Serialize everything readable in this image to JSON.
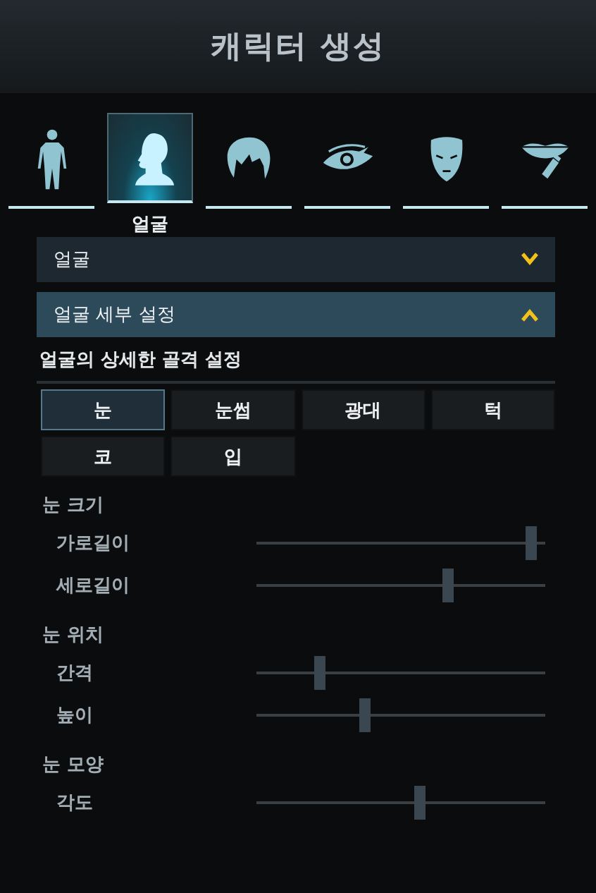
{
  "title": "캐릭터 생성",
  "tabs": [
    {
      "kind": "body",
      "selected": false
    },
    {
      "kind": "head",
      "selected": true,
      "label": "얼굴"
    },
    {
      "kind": "hair",
      "selected": false
    },
    {
      "kind": "eye",
      "selected": false
    },
    {
      "kind": "face",
      "selected": false
    },
    {
      "kind": "makeup",
      "selected": false
    }
  ],
  "sections": [
    {
      "label": "얼굴",
      "expanded": false
    },
    {
      "label": "얼굴 세부 설정",
      "expanded": true
    }
  ],
  "subtitle": "얼굴의 상세한 골격 설정",
  "parts": [
    {
      "label": "눈",
      "selected": true
    },
    {
      "label": "눈썹",
      "selected": false
    },
    {
      "label": "광대",
      "selected": false
    },
    {
      "label": "턱",
      "selected": false
    },
    {
      "label": "코",
      "selected": false
    },
    {
      "label": "입",
      "selected": false
    }
  ],
  "groups": [
    {
      "title": "눈 크기",
      "sliders": [
        {
          "label": "가로길이",
          "level": 0.97
        },
        {
          "label": "세로길이",
          "level": 0.67
        }
      ]
    },
    {
      "title": "눈 위치",
      "sliders": [
        {
          "label": "간격",
          "level": 0.21
        },
        {
          "label": "높이",
          "level": 0.37
        }
      ]
    },
    {
      "title": "눈 모양",
      "sliders": [
        {
          "label": "각도",
          "level": 0.57
        }
      ]
    }
  ]
}
